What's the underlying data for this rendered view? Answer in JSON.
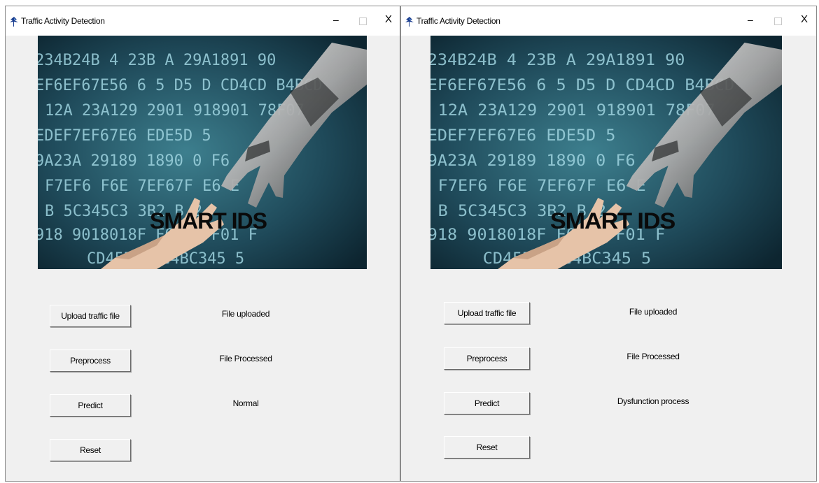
{
  "windows": [
    {
      "title": "Traffic Activity Detection",
      "controls": {
        "minimize": "–",
        "close": "X"
      },
      "banner": {
        "overlay_text": "SMART IDS",
        "hex_rows": [
          "234B24B 4 23B A 29A1891 90",
          "EF6EF67E56 6 5 D5 D CD4CD B4BCD",
          "12A 23A129 2901 918901 78F07",
          "EDEF7EF67E6 EDE5D 5",
          "9A23A 29189 1890 0 F6",
          "F7EF6 F6E 7EF67F E6 E",
          "B 5C345C3 3B2 B 2",
          "918 9018018F F08 67F01 F",
          "CD45D 4BC4BC345 5"
        ]
      },
      "buttons": {
        "upload": "Upload traffic file",
        "preprocess": "Preprocess",
        "predict": "Predict",
        "reset": "Reset"
      },
      "status": {
        "upload": "File uploaded",
        "preprocess": "File Processed",
        "predict": "Normal"
      }
    },
    {
      "title": "Traffic Activity Detection",
      "controls": {
        "minimize": "–",
        "close": "X"
      },
      "banner": {
        "overlay_text": "SMART IDS",
        "hex_rows": [
          "234B24B 4 23B A 29A1891 90",
          "EF6EF67E56 6 5 D5 D CD4CD B4BCD",
          "12A 23A129 2901 918901 78F07",
          "EDEF7EF67E6 EDE5D 5",
          "9A23A 29189 1890 0 F6",
          "F7EF6 F6E 7EF67F E6 E",
          "B 5C345C3 3B2 B 2",
          "918 9018018F F08 67F01 F",
          "CD45D 4BC4BC345 5"
        ]
      },
      "buttons": {
        "upload": "Upload traffic file",
        "preprocess": "Preprocess",
        "predict": "Predict",
        "reset": "Reset"
      },
      "status": {
        "upload": "File uploaded",
        "preprocess": "File Processed",
        "predict": "Dysfunction process"
      }
    }
  ],
  "colors": {
    "banner_bg": "#1f4a5a",
    "hex_text": "#9fd4e0",
    "overlay_text": "#0a0a0a",
    "window_bg": "#f0f0f0"
  }
}
